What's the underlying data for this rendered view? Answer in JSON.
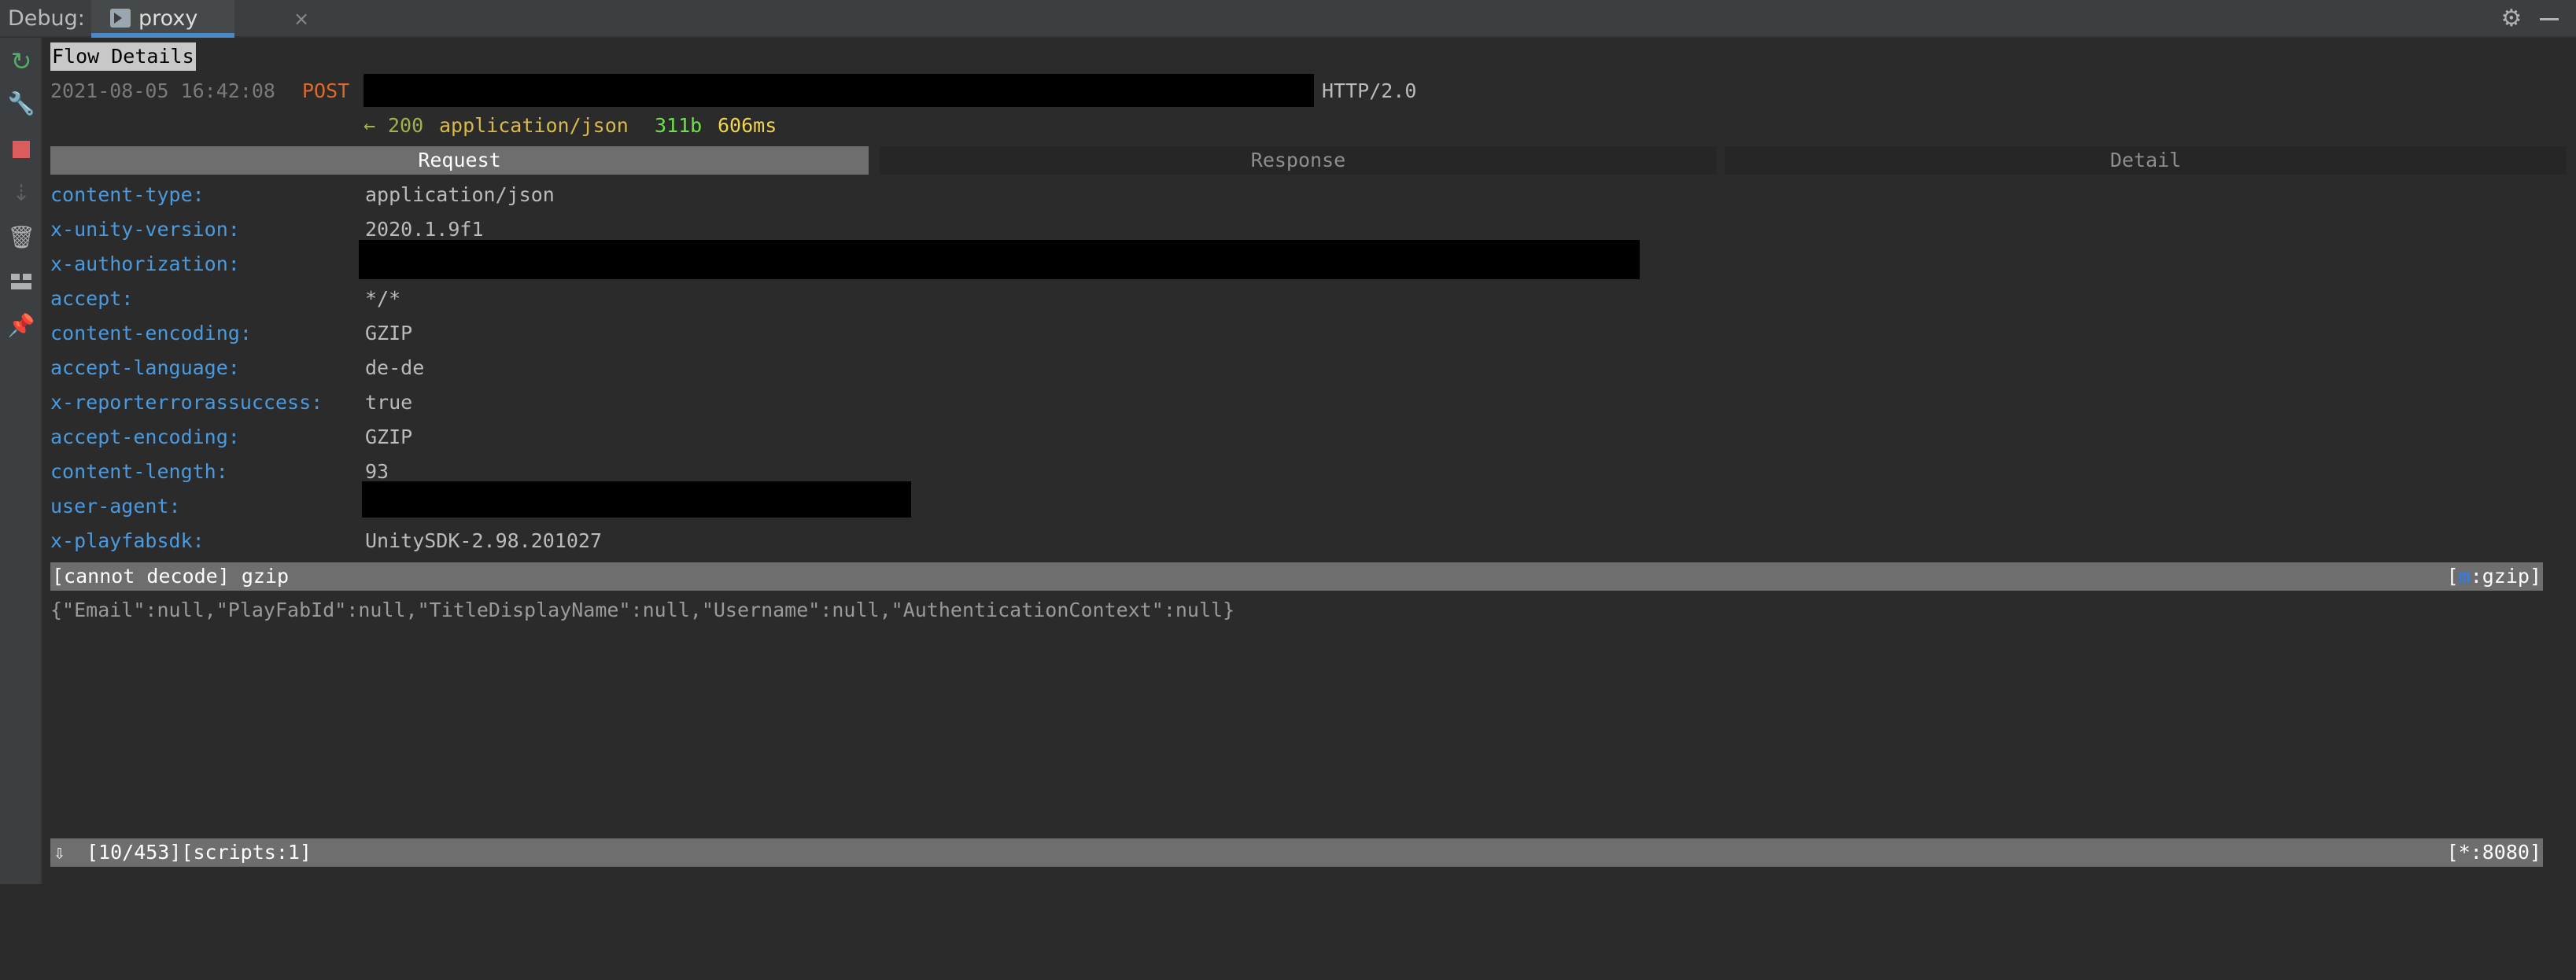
{
  "ide": {
    "debug_label": "Debug:",
    "tab_label": "proxy",
    "tab_close": "×",
    "gear_icon": "⚙",
    "toolbar_icons": [
      "rerun-icon",
      "wrench-icon",
      "stop-icon",
      "step-icon",
      "trash-icon",
      "layout-icon",
      "pin-icon"
    ],
    "rerun_glyph": "↻",
    "wrench_glyph": "🔧",
    "step_glyph": "⇣",
    "delete_glyph": "🗑",
    "pin_glyph": "📌"
  },
  "flow": {
    "title": "Flow Details",
    "timestamp": "2021-08-05 16:42:08",
    "method": "POST",
    "protocol": "HTTP/2.0",
    "response": {
      "arrow": "←",
      "status": "200",
      "content_type": "application/json",
      "size": "311b",
      "time": "606ms"
    }
  },
  "tabs": {
    "request": "Request",
    "response": "Response",
    "detail": "Detail",
    "active": "request"
  },
  "headers": [
    {
      "key": "content-type:",
      "value": "application/json"
    },
    {
      "key": "x-unity-version:",
      "value": "2020.1.9f1"
    },
    {
      "key": "x-authorization:",
      "value": ""
    },
    {
      "key": "accept:",
      "value": "*/*"
    },
    {
      "key": "content-encoding:",
      "value": "GZIP"
    },
    {
      "key": "accept-language:",
      "value": "de-de"
    },
    {
      "key": "x-reporterrorassuccess:",
      "value": "true"
    },
    {
      "key": "accept-encoding:",
      "value": "GZIP"
    },
    {
      "key": "content-length:",
      "value": "93"
    },
    {
      "key": "user-agent:",
      "value": ""
    },
    {
      "key": "x-playfabsdk:",
      "value": "UnitySDK-2.98.201027"
    }
  ],
  "decode": {
    "left": "[cannot decode] gzip",
    "right_open": "[",
    "right_key": "m",
    "right_rest": ":gzip]"
  },
  "body": "{\"Email\":null,\"PlayFabId\":null,\"TitleDisplayName\":null,\"Username\":null,\"AuthenticationContext\":null}",
  "status": {
    "arrow": "⇩",
    "left": "[10/453][scripts:1]",
    "right": "[*:8080]"
  },
  "colors": {
    "header_key": "#4a9ae0",
    "method": "#e0692a",
    "status_code": "#9fb34a",
    "content_type": "#d8b94a",
    "size": "#6fe04d",
    "time": "#f0d64c",
    "active_tab_bg": "#6e6e6e",
    "ide_tab_underline": "#4a88c7"
  }
}
